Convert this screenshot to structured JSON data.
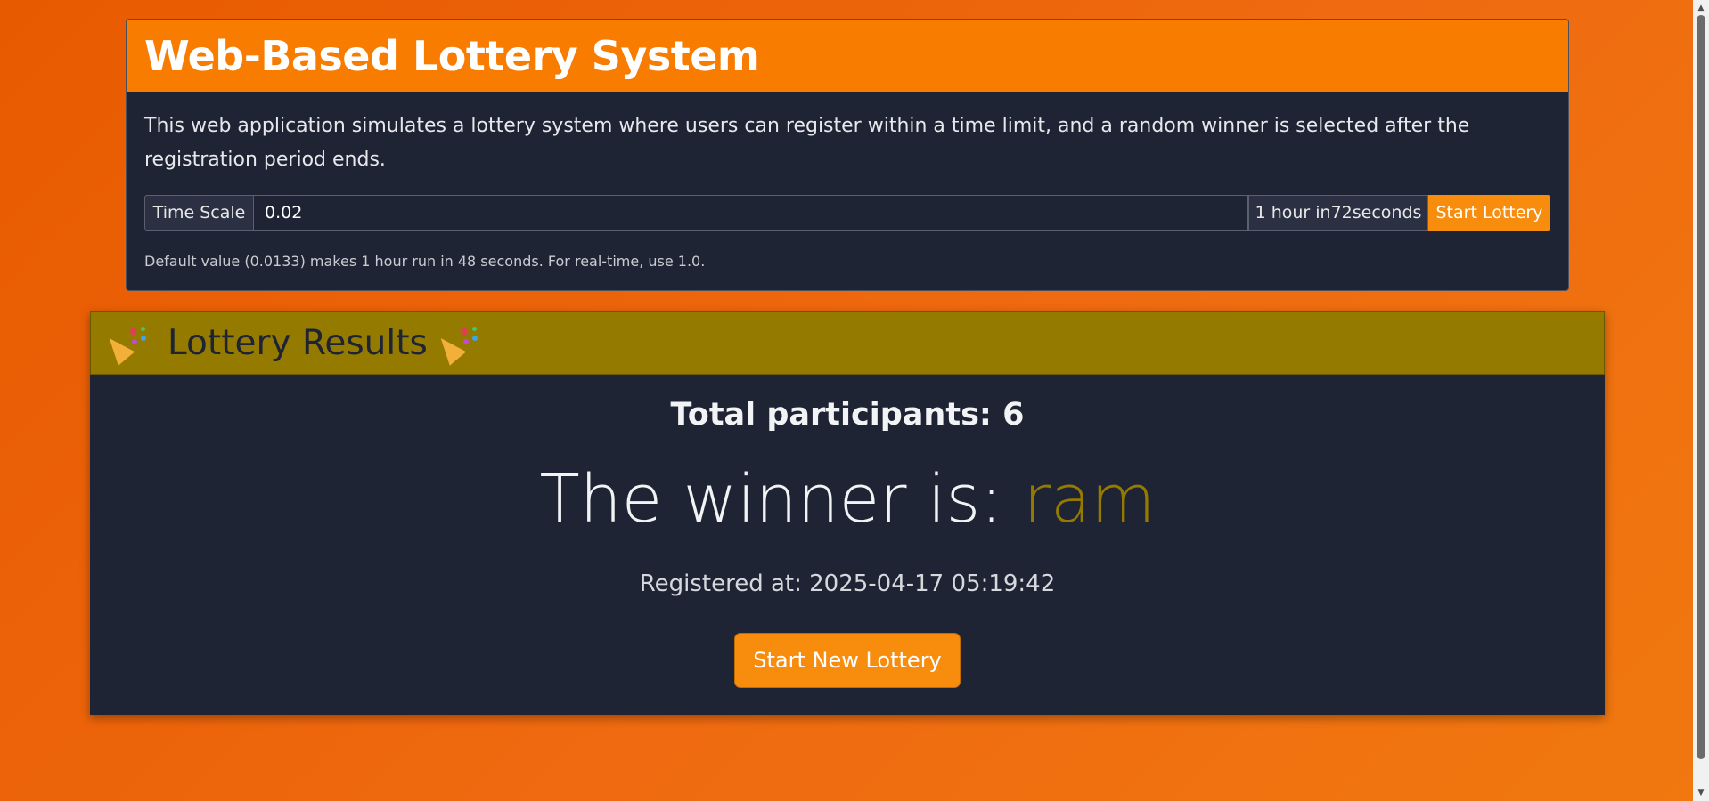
{
  "app": {
    "title": "Web-Based Lottery System",
    "description": "This web application simulates a lottery system where users can register within a time limit, and a random winner is selected after the registration period ends."
  },
  "settings": {
    "time_scale_label": "Time Scale",
    "time_scale_value": "0.02",
    "duration_text": "1 hour in72seconds",
    "start_button_label": "Start Lottery",
    "help_text": "Default value (0.0133) makes 1 hour run in 48 seconds. For real-time, use 1.0."
  },
  "results": {
    "title": "Lottery Results",
    "header_icon": "party-popper-icon",
    "total_participants": "Total participants: 6",
    "winner_prefix": "The winner is: ",
    "winner_name": "ram",
    "registered_at": "Registered at: 2025-04-17 05:19:42",
    "new_lottery_button_label": "Start New Lottery"
  },
  "colors": {
    "background": "#ec6504",
    "header_orange": "#f77c00",
    "card_dark": "#1e2433",
    "results_header": "#957a00",
    "button_orange": "#f88c0d",
    "winner_name": "#957a00"
  }
}
